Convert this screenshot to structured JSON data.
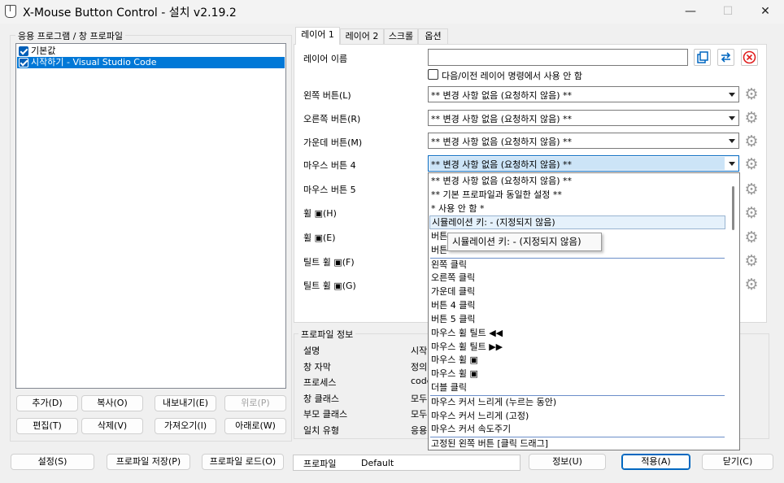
{
  "window": {
    "title": "X-Mouse Button Control - 설치 v2.19.2",
    "minimize": "—",
    "maximize": "☐",
    "close": "✕"
  },
  "profiles": {
    "group_label": "응용 프로그램 / 창 프로파일",
    "items": [
      {
        "label": "기본값",
        "checked": true,
        "selected": false
      },
      {
        "label": "시작하기 - Visual Studio Code",
        "checked": true,
        "selected": true
      }
    ],
    "buttons": {
      "add": "추가(D)",
      "copy": "복사(O)",
      "export": "내보내기(E)",
      "up": "위로(P)",
      "edit": "편집(T)",
      "delete": "삭제(V)",
      "import": "가져오기(I)",
      "down": "아래로(W)"
    }
  },
  "tabs": [
    "레이어 1",
    "레이어 2",
    "스크롤",
    "옵션"
  ],
  "layer": {
    "name_label": "레이어 이름",
    "name_value": "",
    "disable_label": "다음/이전 레이어 명령에서 사용 안 함",
    "rows": [
      {
        "label": "왼쪽 버튼(L)",
        "value": "** 변경 사항 없음 (요청하지 않음) **"
      },
      {
        "label": "오른쪽 버튼(R)",
        "value": "** 변경 사항 없음 (요청하지 않음) **"
      },
      {
        "label": "가운데 버튼(M)",
        "value": "** 변경 사항 없음 (요청하지 않음) **"
      },
      {
        "label": "마우스 버튼 4",
        "value": "** 변경 사항 없음 (요청하지 않음) **"
      },
      {
        "label": "마우스 버튼 5",
        "value": ""
      },
      {
        "label": "휠 ▣(H)",
        "value": ""
      },
      {
        "label": "휠 ▣(E)",
        "value": ""
      },
      {
        "label": "틸트 휠 ▣(F)",
        "value": ""
      },
      {
        "label": "틸트 휠 ▣(G)",
        "value": ""
      }
    ]
  },
  "dropdown": {
    "items": [
      "** 변경 사항 없음 (요청하지 않음) **",
      "** 기본 프로파일과 동일한 설정 **",
      "* 사용 안 함 *",
      "시뮬레이션 키: - (지정되지 않음)",
      "버튼",
      "버튼",
      "왼쪽 클릭",
      "오른쪽 클릭",
      "가운데 클릭",
      "버튼 4 클릭",
      "버튼 5 클릭",
      "마우스 휠 틸트 ◀◀",
      "마우스 휠 틸트 ▶▶",
      "마우스 휠 ▣",
      "마우스 휠 ▣",
      "더블 클릭",
      "마우스 커서 느리게 (누르는 동안)",
      "마우스 커서 느리게 (고정)",
      "마우스 커서 속도주기",
      "고정된 왼쪽 버튼 [클릭 드래그]"
    ],
    "hovered_index": 3,
    "tooltip": "시뮬레이션 키: - (지정되지 않음)"
  },
  "profile_info": {
    "group_label": "프로파일 정보",
    "rows": [
      {
        "label": "설명",
        "value": "시작"
      },
      {
        "label": "창 자막",
        "value": "정의"
      },
      {
        "label": "프로세스",
        "value": "code"
      },
      {
        "label": "창 클래스",
        "value": "모두"
      },
      {
        "label": "부모 클래스",
        "value": "모두"
      },
      {
        "label": "일치 유형",
        "value": "응용"
      }
    ]
  },
  "bottom": {
    "settings": "설정(S)",
    "save_profile": "프로파일 저장(P)",
    "load_profile": "프로파일 로드(O)",
    "profile_label": "프로파일",
    "profile_value": "Default",
    "info": "정보(U)",
    "apply": "적용(A)",
    "close": "닫기(C)"
  },
  "colors": {
    "selection": "#0078d7",
    "accent": "#0067c0",
    "remove_icon": "#e02020"
  }
}
